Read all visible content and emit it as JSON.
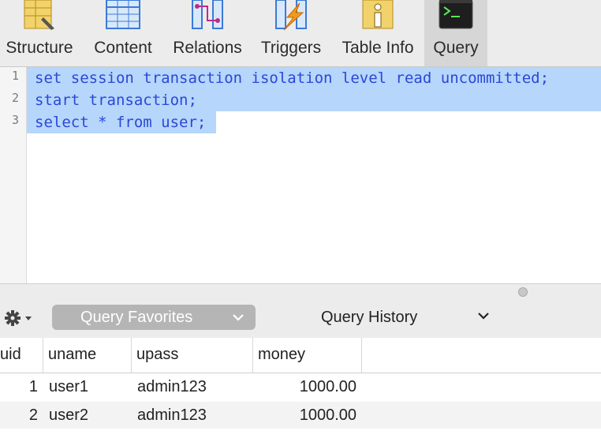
{
  "toolbar": {
    "items": [
      {
        "label": "Structure",
        "icon": "structure-icon"
      },
      {
        "label": "Content",
        "icon": "content-icon"
      },
      {
        "label": "Relations",
        "icon": "relations-icon"
      },
      {
        "label": "Triggers",
        "icon": "triggers-icon"
      },
      {
        "label": "Table Info",
        "icon": "table-info-icon"
      },
      {
        "label": "Query",
        "icon": "terminal-icon",
        "active": true
      }
    ]
  },
  "editor": {
    "line_numbers": [
      "1",
      "2",
      "3"
    ],
    "lines": [
      "set session transaction isolation level read uncommitted;",
      "start transaction;",
      "select * from user;"
    ]
  },
  "bottom_bar": {
    "favorites_label": "Query Favorites",
    "history_label": "Query History"
  },
  "results": {
    "columns": [
      "uid",
      "uname",
      "upass",
      "money"
    ],
    "rows": [
      [
        "1",
        "user1",
        "admin123",
        "1000.00"
      ],
      [
        "2",
        "user2",
        "admin123",
        "1000.00"
      ]
    ]
  },
  "colors": {
    "selection": "#b6d6fb",
    "keyword": "#2a48d6",
    "toolbar_bg": "#ececec",
    "active_tab": "#d6d6d6"
  }
}
